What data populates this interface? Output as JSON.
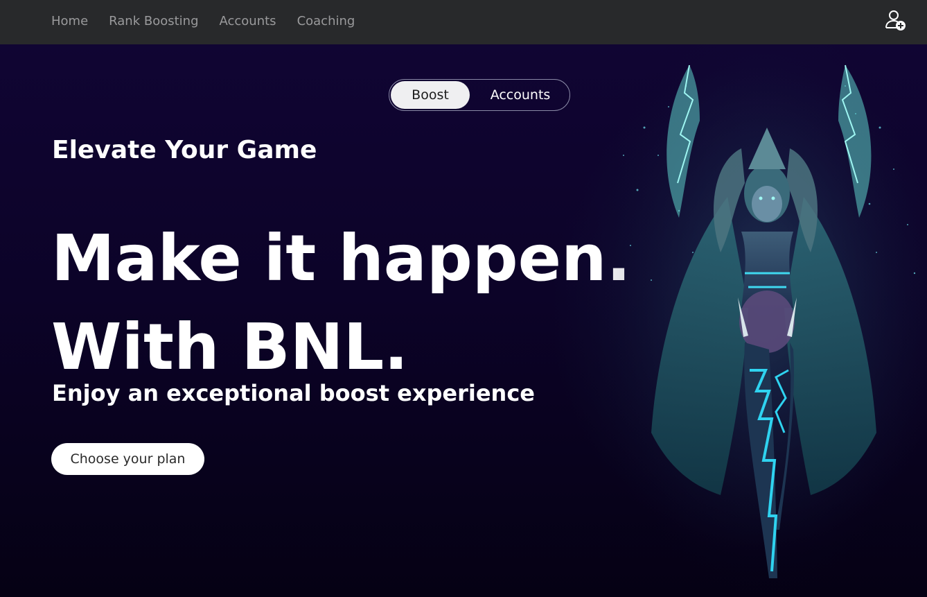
{
  "nav": {
    "links": [
      "Home",
      "Rank Boosting",
      "Accounts",
      "Coaching"
    ],
    "user_icon": "user-add-icon"
  },
  "toggle": {
    "active": "Boost",
    "inactive": "Accounts"
  },
  "hero": {
    "subtitle": "Elevate Your Game",
    "headline_line1": "Make it happen.",
    "headline_line2": "With BNL.",
    "tagline": "Enjoy an exceptional boost experience",
    "cta": "Choose your plan"
  },
  "colors": {
    "nav_bg": "#28292b",
    "hero_bg": "#0c0328",
    "accent": "#3fd8d8"
  }
}
